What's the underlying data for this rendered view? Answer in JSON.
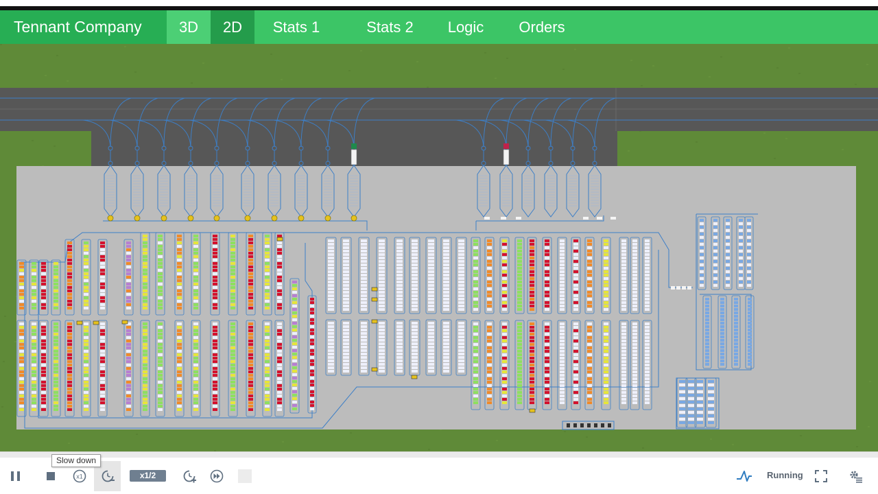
{
  "app": {
    "brand": "Tennant Company"
  },
  "nav": {
    "tabs": [
      {
        "label": "3D",
        "active": false
      },
      {
        "label": "2D",
        "active": true
      },
      {
        "label": "Stats 1",
        "active": false
      },
      {
        "label": "Stats 2",
        "active": false
      },
      {
        "label": "Logic",
        "active": false
      },
      {
        "label": "Orders",
        "active": false
      }
    ]
  },
  "toolbar": {
    "pause_icon": "pause-icon",
    "stop_icon": "stop-icon",
    "realtime_icon": "realtime-x1-icon",
    "realtime_text": "x1",
    "slowdown_icon": "slow-down-icon",
    "speed": "x1/2",
    "speedup_icon": "speed-up-icon",
    "fastforward_icon": "fast-forward-icon",
    "status_icon": "model-status-icon",
    "status": "Running",
    "fullscreen_icon": "fullscreen-icon",
    "settings_icon": "settings-icon"
  },
  "tooltip": {
    "text": "Slow down"
  },
  "colors": {
    "nav_green": "#3cc566",
    "nav_brand_green": "#27ae54",
    "nav_active_green": "#249c4b",
    "grass": "#5f8a38",
    "road": "#575757",
    "floor": "#bcbcbc",
    "path_blue": "#3d7fc7",
    "rack_white": "#eef0fb",
    "rack_red": "#d4122e",
    "rack_orange": "#f08a2a",
    "rack_yellow": "#e6e63a",
    "rack_green": "#8ee060",
    "rack_purple": "#b77fd1",
    "rack_blue": "#79a8e3",
    "agv_yellow": "#e6c21e"
  }
}
